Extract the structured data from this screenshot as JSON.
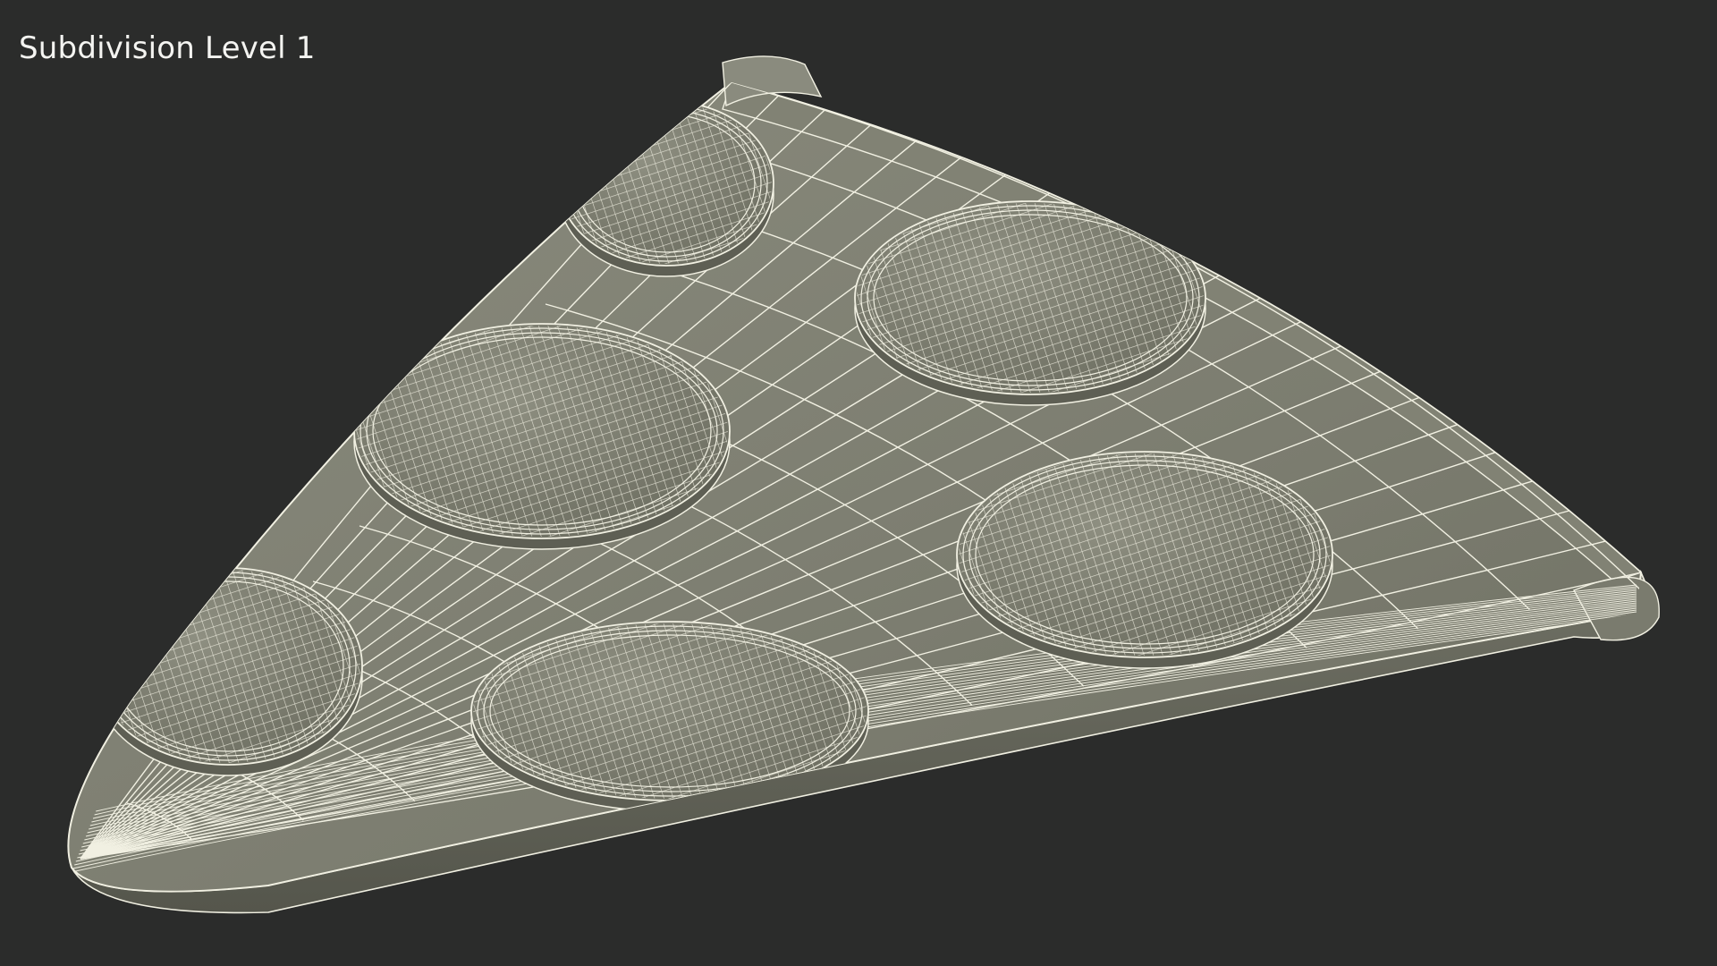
{
  "viewport": {
    "caption": "Subdivision Level 1",
    "background": "#2b2c2b"
  },
  "model": {
    "subject": "pizza-slice",
    "render_style": "wireframe-on-shaded",
    "surface_color": "#7d7e70",
    "wire_color": "#f1f0e2",
    "pepperoni_count": 6
  }
}
